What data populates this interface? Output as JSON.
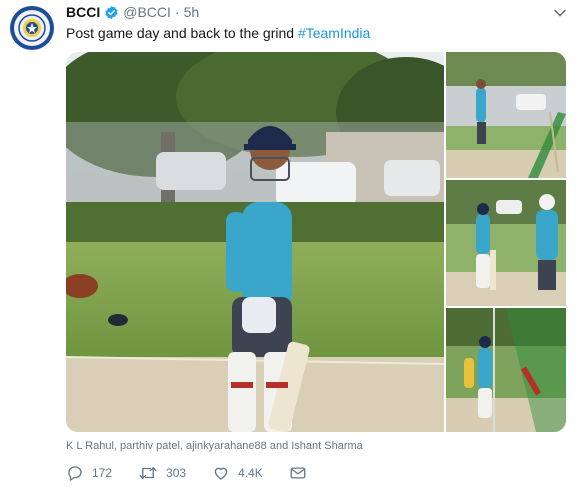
{
  "tweet": {
    "author_name": "BCCI",
    "handle": "@BCCI",
    "separator": "·",
    "time": "5h",
    "text_main": "Post game day and back to the grind ",
    "hashtag": "#TeamIndia",
    "caption": "K L Rahul, parthiv patel, ajinkyarahane88 and Ishant Sharma"
  },
  "actions": {
    "replies": "172",
    "retweets": "303",
    "likes": "4.4K"
  },
  "icons": {
    "avatar": "bcci-logo-icon",
    "verified": "verified-badge-icon",
    "menu": "chevron-down-icon",
    "reply": "reply-icon",
    "retweet": "retweet-icon",
    "like": "heart-icon",
    "message": "envelope-icon"
  },
  "colors": {
    "link": "#1b95e0",
    "muted": "#657786",
    "brand_blue": "#1d4d9a"
  }
}
